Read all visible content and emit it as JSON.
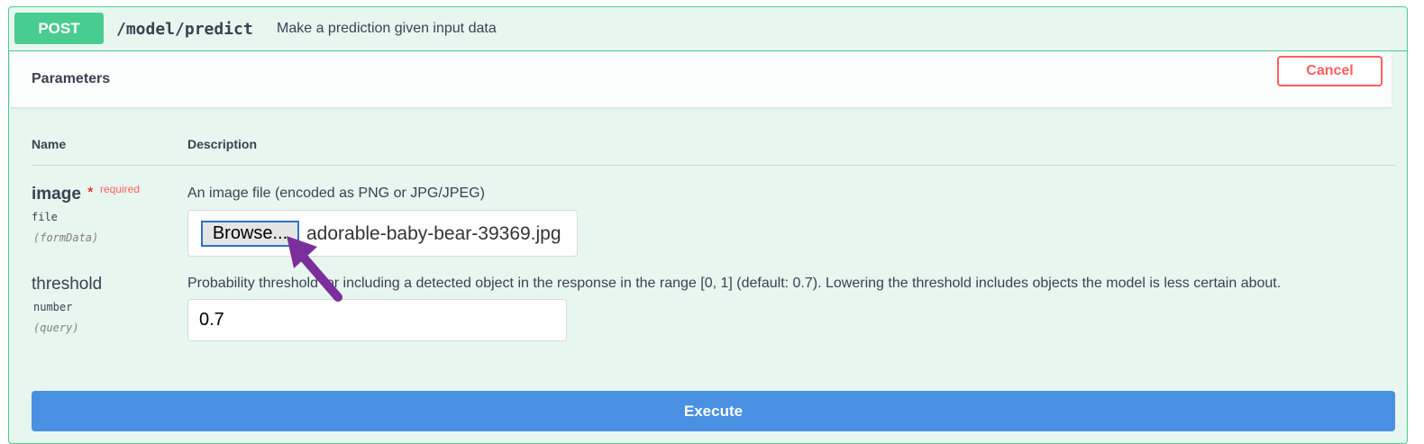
{
  "operation": {
    "method": "POST",
    "path": "/model/predict",
    "summary": "Make a prediction given input data"
  },
  "parameters_section": {
    "title": "Parameters",
    "cancel_label": "Cancel",
    "columns": {
      "name": "Name",
      "description": "Description"
    }
  },
  "params": [
    {
      "name": "image",
      "required_star": "*",
      "required_label": "required",
      "type": "file",
      "in": "(formData)",
      "description": "An image file (encoded as PNG or JPG/JPEG)",
      "browse_label": "Browse...",
      "file_name": "adorable-baby-bear-39369.jpg"
    },
    {
      "name": "threshold",
      "type": "number",
      "in": "(query)",
      "description": "Probability threshold for including a detected object in the response in the range [0, 1] (default: 0.7). Lowering the threshold includes objects the model is less certain about.",
      "value": "0.7"
    }
  ],
  "execute_label": "Execute",
  "colors": {
    "post": "#49cc90",
    "cancel": "#ff6060",
    "execute": "#4990e2",
    "arrow": "#7a2f9c"
  },
  "icons": {
    "pointer": "arrow-pointer-icon"
  }
}
